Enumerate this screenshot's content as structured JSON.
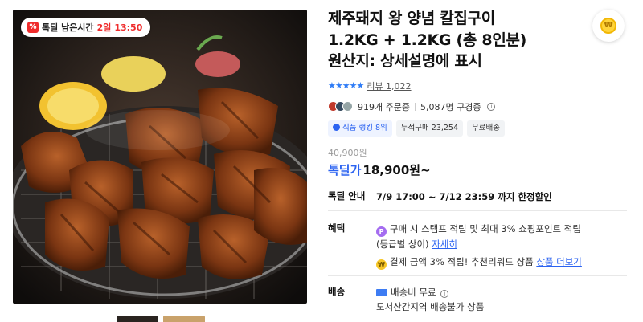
{
  "deal_badge": {
    "icon": "percent-tag-icon",
    "label": "톡딜 남은시간",
    "days": "2일",
    "time": "13:50"
  },
  "product": {
    "title_lines": [
      "제주돼지 왕 양념 칼집구이",
      "1.2KG + 1.2KG (총 8인분)",
      "원산지: 상세설명에 표시"
    ],
    "rating_stars": "★★★★★",
    "review_label": "리뷰 1,022",
    "orders": "919개 주문중",
    "subscribers": "5,087명 구경중",
    "chips": [
      "식품 랭킹 8위",
      "누적구매 23,254",
      "무료배송"
    ],
    "original_price": "40,900원",
    "deal_label": "톡딜가",
    "deal_price": "18,900원~"
  },
  "deal_info": {
    "label": "톡딜 안내",
    "text": "7/9 17:00 ~ 7/12 23:59 까지 한정할인"
  },
  "benefits": {
    "label": "혜택",
    "line1": "구매 시 스탬프 적립 및 최대 3% 쇼핑포인트 적립",
    "line2_prefix": "(등급별 상이)",
    "line2_link": "자세히",
    "line3": "결제 금액 3% 적립! 추천리워드 상품",
    "line3_link": "상품 더보기"
  },
  "shipping": {
    "label": "배송",
    "fee": "배송비 무료",
    "note": "도서산간지역 배송불가 상품"
  },
  "colors": {
    "accent": "#2b63f1",
    "deal_red": "#ef2b2b",
    "star": "#2f7cf6"
  }
}
